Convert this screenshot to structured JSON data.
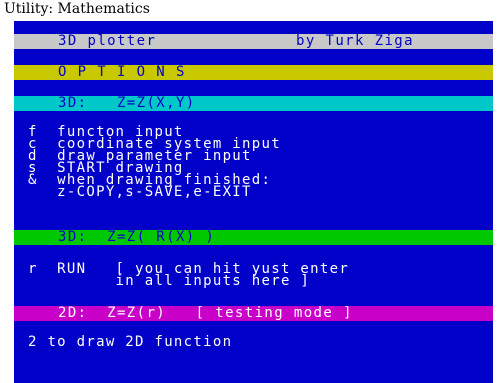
{
  "caption": "Utility: Mathematics",
  "colors": {
    "screen_bg": "#0000c8",
    "grey": "#c8c8c8",
    "yellow": "#c8c800",
    "cyan": "#00c8c8",
    "green": "#00c800",
    "magenta": "#c800c8"
  },
  "title_bar": {
    "left": "3D plotter",
    "right": "by Turk Ziga"
  },
  "options_bar": "O P T I O N S",
  "mode_3d_bar": "3D:   Z=Z(X,Y)",
  "menu_3d": [
    "f  functon input",
    "c  coordinate system input",
    "d  draw parameter input",
    "s  START drawing",
    "&  when drawing finished:",
    "   z-COPY,s-SAVE,e-EXIT"
  ],
  "mode_3d_r_bar": "3D:  Z=Z( R(X) )",
  "run_lines": [
    "r  RUN   [ you can hit yust enter",
    "         in all inputs here ]"
  ],
  "mode_2d_bar": "2D:  Z=Z(r)   [ testing mode ]",
  "draw_2d_line": "2 to draw 2D function"
}
